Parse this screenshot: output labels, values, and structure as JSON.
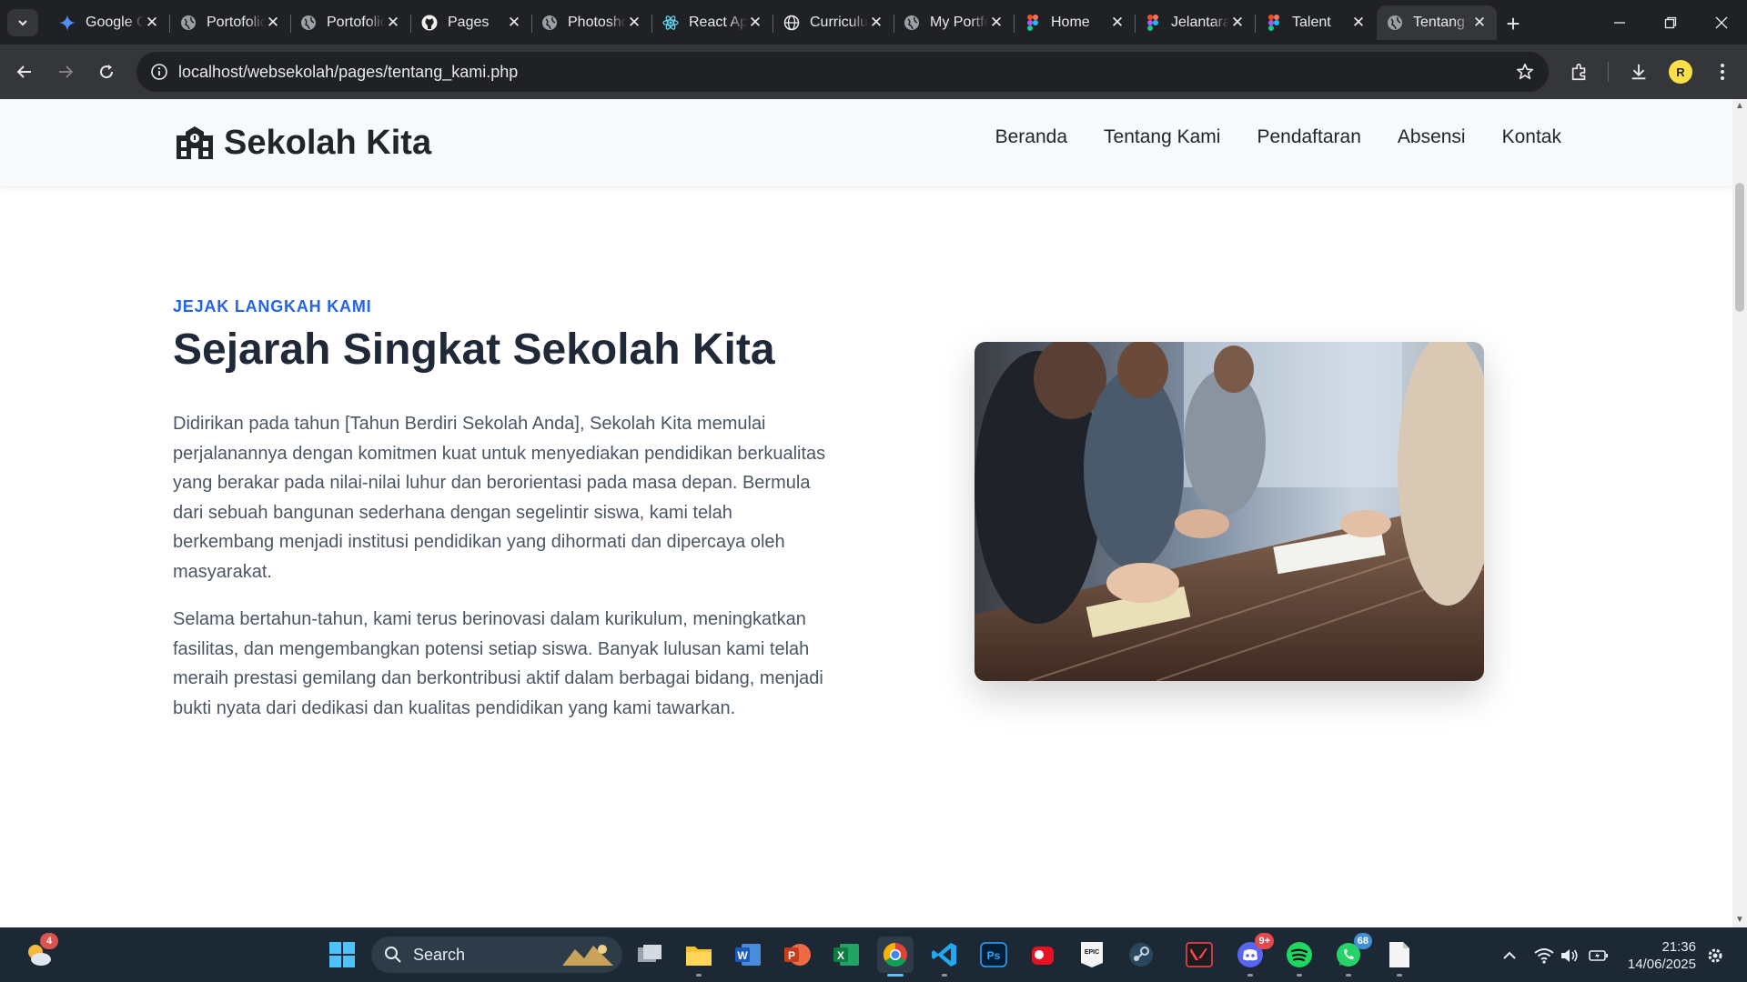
{
  "browser": {
    "tabs": [
      {
        "title": "Google Gemini",
        "icon": "gemini-icon"
      },
      {
        "title": "Portofolio",
        "icon": "globe-icon"
      },
      {
        "title": "Portofolio",
        "icon": "globe-icon"
      },
      {
        "title": "Pages",
        "icon": "github-icon"
      },
      {
        "title": "Photoshop",
        "icon": "globe-icon"
      },
      {
        "title": "React App",
        "icon": "react-icon"
      },
      {
        "title": "Curriculum",
        "icon": "globe-outline-icon"
      },
      {
        "title": "My Portfolio",
        "icon": "globe-icon"
      },
      {
        "title": "Home",
        "icon": "figma-icon"
      },
      {
        "title": "Jelantara",
        "icon": "figma-icon"
      },
      {
        "title": "Talent",
        "icon": "figma-icon"
      },
      {
        "title": "Tentang Kami",
        "icon": "globe-icon",
        "active": true
      }
    ],
    "url": "localhost/websekolah/pages/tentang_kami.php",
    "profile_initial": "R"
  },
  "site": {
    "brand": "Sekolah Kita",
    "nav": [
      "Beranda",
      "Tentang Kami",
      "Pendaftaran",
      "Absensi",
      "Kontak"
    ]
  },
  "about": {
    "eyebrow": "JEJAK LANGKAH KAMI",
    "heading": "Sejarah Singkat Sekolah Kita",
    "paragraph_1": "Didirikan pada tahun [Tahun Berdiri Sekolah Anda], Sekolah Kita memulai perjalanannya dengan komitmen kuat untuk menyediakan pendidikan berkualitas yang berakar pada nilai-nilai luhur dan berorientasi pada masa depan. Bermula dari sebuah bangunan sederhana dengan segelintir siswa, kami telah berkembang menjadi institusi pendidikan yang dihormati dan dipercaya oleh masyarakat.",
    "paragraph_2": "Selama bertahun-tahun, kami terus berinovasi dalam kurikulum, meningkatkan fasilitas, dan mengembangkan potensi setiap siswa. Banyak lulusan kami telah meraih prestasi gemilang dan berkontribusi aktif dalam berbagai bidang, menjadi bukti nyata dari dedikasi dan kualitas pendidikan yang kami tawarkan."
  },
  "taskbar": {
    "search_label": "Search",
    "weather_badge": "4",
    "discord_badge": "9+",
    "whatsapp_badge": "68",
    "time": "21:36",
    "date": "14/06/2025"
  },
  "colors": {
    "accent": "#2563eb",
    "heading": "#1f2937",
    "body_text": "#4b5563",
    "chrome_dark": "#202124",
    "chrome_toolbar": "#35363a"
  }
}
